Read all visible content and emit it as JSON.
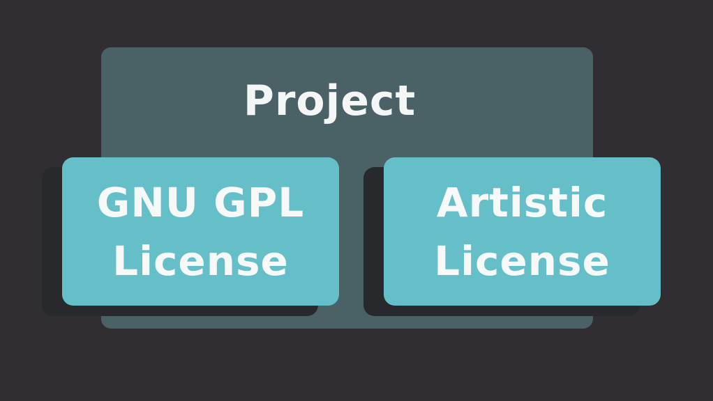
{
  "diagram": {
    "project": {
      "label": "Project"
    },
    "licenses": [
      {
        "line1": "GNU GPL",
        "line2": "License"
      },
      {
        "line1": "Artistic",
        "line2": "License"
      }
    ]
  },
  "colors": {
    "background": "#302e33",
    "project_box": "#4a6266",
    "license_box": "#65bfc8",
    "shadow": "#27292c",
    "text": "#f7f9f9"
  }
}
